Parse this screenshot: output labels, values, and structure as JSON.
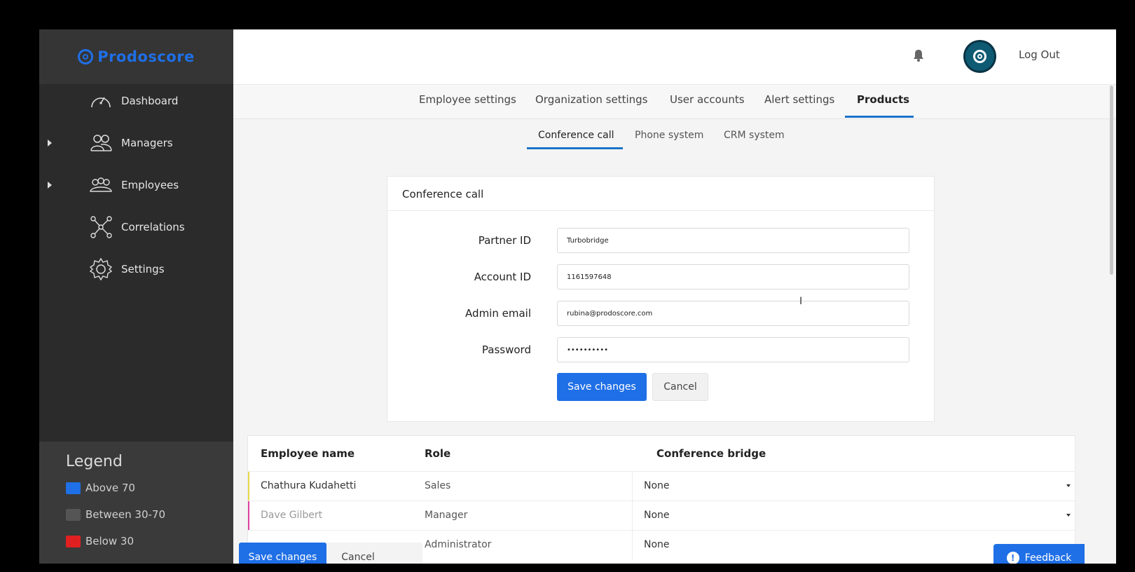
{
  "brand": {
    "name": "Prodoscore"
  },
  "sidebar": {
    "items": [
      {
        "label": "Dashboard",
        "icon": "gauge-icon"
      },
      {
        "label": "Managers",
        "icon": "managers-icon"
      },
      {
        "label": "Employees",
        "icon": "employees-icon"
      },
      {
        "label": "Correlations",
        "icon": "network-icon"
      },
      {
        "label": "Settings",
        "icon": "gear-icon"
      }
    ]
  },
  "legend": {
    "title": "Legend",
    "items": [
      {
        "label": "Above 70",
        "color": "#1f6fe6"
      },
      {
        "label": "Between 30-70",
        "color": "#555555"
      },
      {
        "label": "Below 30",
        "color": "#e02020"
      }
    ]
  },
  "header": {
    "logout_label": "Log Out"
  },
  "tabs": [
    "Employee settings",
    "Organization settings",
    "User accounts",
    "Alert settings",
    "Products"
  ],
  "active_tab": "Products",
  "subtabs": [
    "Conference call",
    "Phone system",
    "CRM system"
  ],
  "active_subtab": "Conference call",
  "card": {
    "title": "Conference call",
    "fields": {
      "partner_id": {
        "label": "Partner ID",
        "value": "Turbobridge"
      },
      "account_id": {
        "label": "Account ID",
        "value": "1161597648"
      },
      "admin_email": {
        "label": "Admin email",
        "value": "rubina@prodoscore.com"
      },
      "password": {
        "label": "Password",
        "value": "••••••••••"
      }
    },
    "save_label": "Save changes",
    "cancel_label": "Cancel"
  },
  "table": {
    "headers": {
      "name": "Employee name",
      "role": "Role",
      "bridge": "Conference bridge"
    },
    "rows": [
      {
        "name": "Chathura Kudahetti",
        "role": "Sales",
        "bridge": "None",
        "marker": "#e8d84a"
      },
      {
        "name": "Dave Gilbert",
        "role": "Manager",
        "bridge": "None",
        "marker": "#e040a0"
      },
      {
        "name": "",
        "role": "Administrator",
        "bridge": "None",
        "marker": "#ffffff"
      }
    ]
  },
  "bottom_bar": {
    "save_label": "Save changes",
    "cancel_label": "Cancel"
  },
  "feedback": {
    "label": "Feedback"
  },
  "colors": {
    "accent": "#1f6fe6",
    "sidebar": "#2b2b2b",
    "tab_underline": "#1b73c9"
  }
}
